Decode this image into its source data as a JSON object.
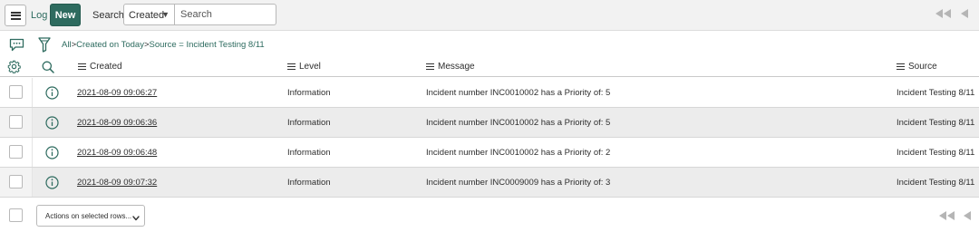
{
  "header": {
    "title": "Log",
    "new_label": "New",
    "search_label": "Search",
    "search_field": "Created",
    "search_placeholder": "Search"
  },
  "breadcrumb": {
    "all": "All",
    "sep1": ">",
    "filter1": "Created on Today",
    "sep2": ">",
    "filter2": "Source = Incident Testing 8/11"
  },
  "columns": {
    "created": "Created",
    "level": "Level",
    "message": "Message",
    "source": "Source"
  },
  "rows": [
    {
      "created": "2021-08-09 09:06:27",
      "level": "Information",
      "message": "Incident number INC0010002 has a Priority of: 5",
      "source": "Incident Testing 8/11"
    },
    {
      "created": "2021-08-09 09:06:36",
      "level": "Information",
      "message": "Incident number INC0010002 has a Priority of: 5",
      "source": "Incident Testing 8/11"
    },
    {
      "created": "2021-08-09 09:06:48",
      "level": "Information",
      "message": "Incident number INC0010002 has a Priority of: 2",
      "source": "Incident Testing 8/11"
    },
    {
      "created": "2021-08-09 09:07:32",
      "level": "Information",
      "message": "Incident number INC0009009 has a Priority of: 3",
      "source": "Incident Testing 8/11"
    }
  ],
  "footer": {
    "actions_label": "Actions on selected rows..."
  },
  "icons": {
    "menu": "hamburger-icon",
    "chat": "chat-icon",
    "filter": "filter-icon",
    "settings": "gear-icon",
    "search": "magnifier-icon",
    "info": "info-icon",
    "first_page": "double-chevron-left-icon",
    "prev_page": "chevron-left-icon"
  },
  "colors": {
    "accent": "#2e6b5f",
    "header_bg": "#f2f2f2",
    "row_alt_bg": "#ececec",
    "pager_disabled": "#b5b5b5"
  }
}
